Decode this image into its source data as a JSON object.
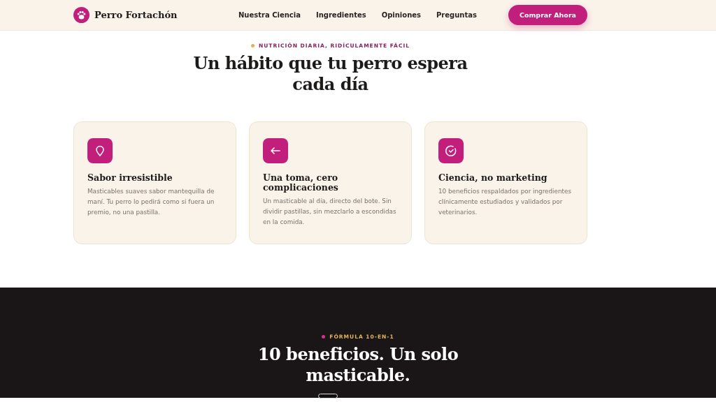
{
  "nav": {
    "brand": "Perro Fortachón",
    "links": [
      "Nuestra Ciencia",
      "Ingredientes",
      "Opiniones",
      "Preguntas"
    ],
    "cta": "Comprar Ahora"
  },
  "habit": {
    "eyebrow": "NUTRICIÓN DIARIA, RIDÍCULAMENTE FÁCIL",
    "title": "Un hábito que tu perro espera cada día",
    "cards": [
      {
        "title": "Sabor irresistible",
        "text": "Masticables suaves sabor mantequilla de maní. Tu perro lo pedirá como si fuera un premio, no una pastilla."
      },
      {
        "title": "Una toma, cero complicaciones",
        "text": "Un masticable al día, directo del bote. Sin dividir pastillas, sin mezclarlo a escondidas en la comida."
      },
      {
        "title": "Ciencia, no marketing",
        "text": "10 beneficios respaldados por ingredientes clínicamente estudiados y validados por veterinarios."
      }
    ]
  },
  "formula": {
    "eyebrow": "FÓRMULA 10-EN-1",
    "title": "10 beneficios. Un solo masticable."
  }
}
